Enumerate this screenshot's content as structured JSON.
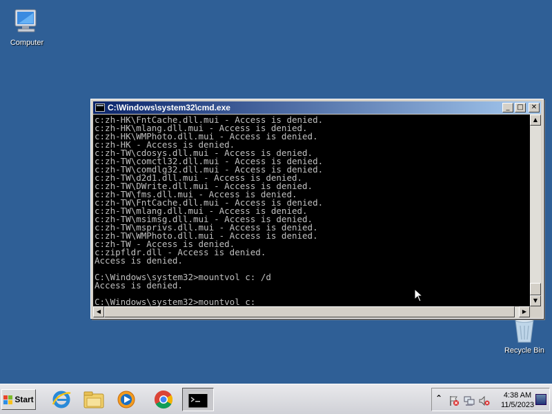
{
  "desktop": {
    "icons": [
      {
        "label": "Computer",
        "icon": "computer-icon"
      },
      {
        "label": "Recycle Bin",
        "icon": "recycle-bin-icon"
      }
    ],
    "background_color": "#2f5f96"
  },
  "cmd_window": {
    "title": "C:\\Windows\\system32\\cmd.exe",
    "controls": {
      "minimize": "_",
      "maximize": "□",
      "close": "✕"
    },
    "lines": [
      "c:zh-HK\\FntCache.dll.mui - Access is denied.",
      "c:zh-HK\\mlang.dll.mui - Access is denied.",
      "c:zh-HK\\WMPhoto.dll.mui - Access is denied.",
      "c:zh-HK - Access is denied.",
      "c:zh-TW\\cdosys.dll.mui - Access is denied.",
      "c:zh-TW\\comctl32.dll.mui - Access is denied.",
      "c:zh-TW\\comdlg32.dll.mui - Access is denied.",
      "c:zh-TW\\d2d1.dll.mui - Access is denied.",
      "c:zh-TW\\DWrite.dll.mui - Access is denied.",
      "c:zh-TW\\fms.dll.mui - Access is denied.",
      "c:zh-TW\\FntCache.dll.mui - Access is denied.",
      "c:zh-TW\\mlang.dll.mui - Access is denied.",
      "c:zh-TW\\msimsg.dll.mui - Access is denied.",
      "c:zh-TW\\msprivs.dll.mui - Access is denied.",
      "c:zh-TW\\WMPhoto.dll.mui - Access is denied.",
      "c:zh-TW - Access is denied.",
      "c:zipfldr.dll - Access is denied.",
      "Access is denied.",
      "",
      "C:\\Windows\\system32>mountvol c: /d",
      "Access is denied.",
      "",
      "C:\\Windows\\system32>mountvol c:"
    ],
    "text_color": "#c0c0c0",
    "background": "#000000"
  },
  "taskbar": {
    "start_label": "Start",
    "pinned": [
      {
        "name": "internet-explorer-icon"
      },
      {
        "name": "file-explorer-icon"
      },
      {
        "name": "media-player-icon"
      },
      {
        "name": "chrome-icon"
      },
      {
        "name": "cmd-icon",
        "active": true
      }
    ],
    "tray": {
      "icons": [
        "chevron-up-icon",
        "action-center-icon",
        "network-icon",
        "volume-muted-icon"
      ],
      "time": "4:38 AM",
      "date": "11/5/2023"
    }
  }
}
